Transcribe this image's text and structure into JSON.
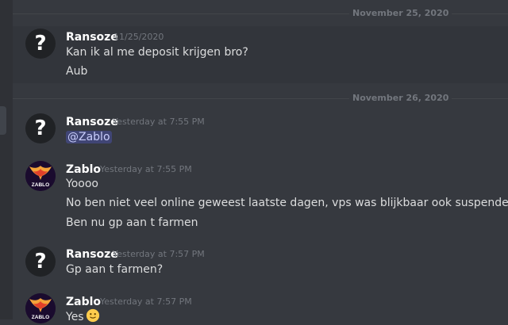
{
  "dividers": {
    "first_date": "November 25, 2020",
    "second_date": "November 26, 2020"
  },
  "messages": [
    {
      "author": "Ransoze",
      "timestamp": "11/25/2020",
      "lines": [
        "Kan ik al me deposit krijgen bro?",
        "Aub"
      ],
      "avatar_icon": "question-mark-icon"
    },
    {
      "author": "Ransoze",
      "timestamp": "Yesterday at 7:55 PM",
      "lines": [
        "@Zablo"
      ],
      "avatar_icon": "question-mark-icon"
    },
    {
      "author": "Zablo",
      "timestamp": "Yesterday at 7:55 PM",
      "lines": [
        "Yoooo",
        "No ben niet veel online geweest laatste dagen, vps was blijkbaar ook suspended",
        "Ben nu gp aan t farmen"
      ],
      "avatar_icon": "phoenix-logo-icon",
      "avatar_text": "ZABLO"
    },
    {
      "author": "Ransoze",
      "timestamp": "Yesterday at 7:57 PM",
      "lines": [
        "Gp aan t farmen?"
      ],
      "avatar_icon": "question-mark-icon"
    },
    {
      "author": "Zablo",
      "timestamp": "Yesterday at 7:57 PM",
      "lines": [
        "Yes"
      ],
      "avatar_icon": "phoenix-logo-icon",
      "avatar_text": "ZABLO",
      "trailing_emoji": "slightly-smiling-face-icon"
    }
  ],
  "colors": {
    "background": "#36393f",
    "mention_text": "#c9cdfb",
    "username": "#ffffff",
    "timestamp": "#72767d"
  }
}
